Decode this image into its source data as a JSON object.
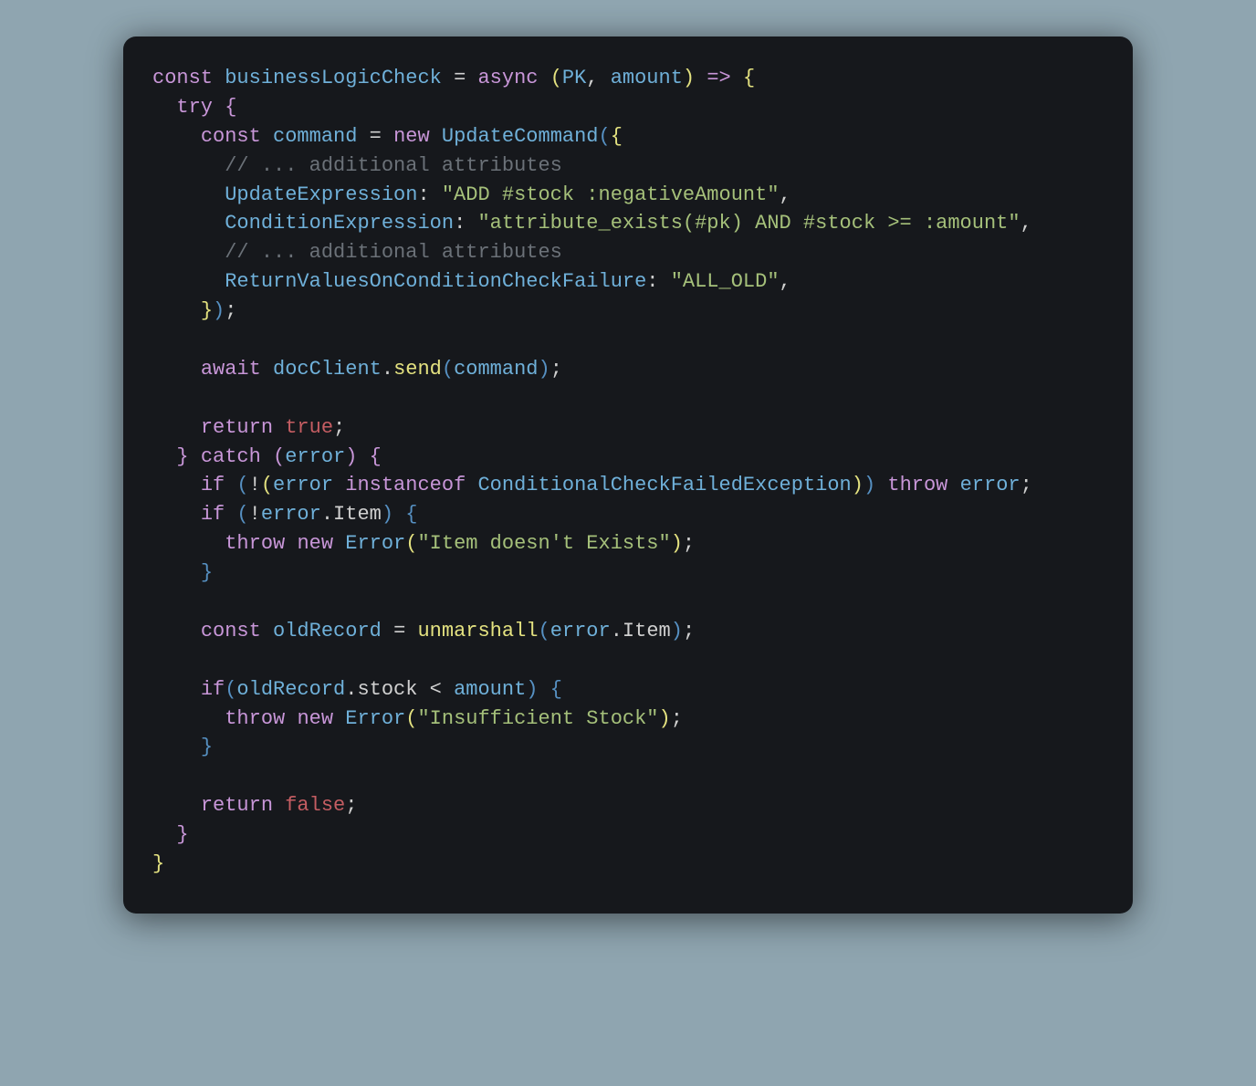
{
  "code": {
    "l1": {
      "const": "const",
      "name": "businessLogicCheck",
      "eq": "=",
      "async": "async",
      "lp": "(",
      "p1": "PK",
      "comma": ", ",
      "p2": "amount",
      "rp": ")",
      "arrow": "=>",
      "lb": "{"
    },
    "l2": {
      "try": "try",
      "lb": "{"
    },
    "l3": {
      "const": "const",
      "name": "command",
      "eq": "=",
      "new": "new",
      "cls": "UpdateCommand",
      "lp": "(",
      "lb": "{"
    },
    "l4": {
      "text": "// ... additional attributes"
    },
    "l5": {
      "key": "UpdateExpression",
      "colon": ":",
      "str": "\"ADD #stock :negativeAmount\"",
      "comma": ","
    },
    "l6": {
      "key": "ConditionExpression",
      "colon": ":",
      "str": "\"attribute_exists(#pk) AND #stock >= :amount\"",
      "comma": ","
    },
    "l7": {
      "text": "// ... additional attributes"
    },
    "l8": {
      "key": "ReturnValuesOnConditionCheckFailure",
      "colon": ":",
      "str": "\"ALL_OLD\"",
      "comma": ","
    },
    "l9": {
      "rb": "}",
      "rp": ")",
      "semi": ";"
    },
    "l11": {
      "await": "await",
      "obj": "docClient",
      "dot": ".",
      "mth": "send",
      "lp": "(",
      "arg": "command",
      "rp": ")",
      "semi": ";"
    },
    "l13": {
      "return": "return",
      "val": "true",
      "semi": ";"
    },
    "l14": {
      "rb": "}",
      "catch": "catch",
      "lp": "(",
      "err": "error",
      "rp": ")",
      "lb": "{"
    },
    "l15": {
      "if": "if",
      "lp": "(",
      "not": "!",
      "lp2": "(",
      "err": "error",
      "inst": "instanceof",
      "cls": "ConditionalCheckFailedException",
      "rp2": ")",
      "rp": ")",
      "throw": "throw",
      "err2": "error",
      "semi": ";"
    },
    "l16": {
      "if": "if",
      "lp": "(",
      "not": "!",
      "err": "error",
      "dot": ".",
      "prop": "Item",
      "rp": ")",
      "lb": "{"
    },
    "l17": {
      "throw": "throw",
      "new": "new",
      "cls": "Error",
      "lp": "(",
      "str": "\"Item doesn't Exists\"",
      "rp": ")",
      "semi": ";"
    },
    "l18": {
      "rb": "}"
    },
    "l20": {
      "const": "const",
      "name": "oldRecord",
      "eq": "=",
      "fn": "unmarshall",
      "lp": "(",
      "err": "error",
      "dot": ".",
      "prop": "Item",
      "rp": ")",
      "semi": ";"
    },
    "l22": {
      "if": "if",
      "lp": "(",
      "obj": "oldRecord",
      "dot": ".",
      "prop": "stock",
      "lt": "<",
      "arg": "amount",
      "rp": ")",
      "lb": "{"
    },
    "l23": {
      "throw": "throw",
      "new": "new",
      "cls": "Error",
      "lp": "(",
      "str": "\"Insufficient Stock\"",
      "rp": ")",
      "semi": ";"
    },
    "l24": {
      "rb": "}"
    },
    "l26": {
      "return": "return",
      "val": "false",
      "semi": ";"
    },
    "l27": {
      "rb": "}"
    },
    "l28": {
      "rb": "}"
    }
  }
}
